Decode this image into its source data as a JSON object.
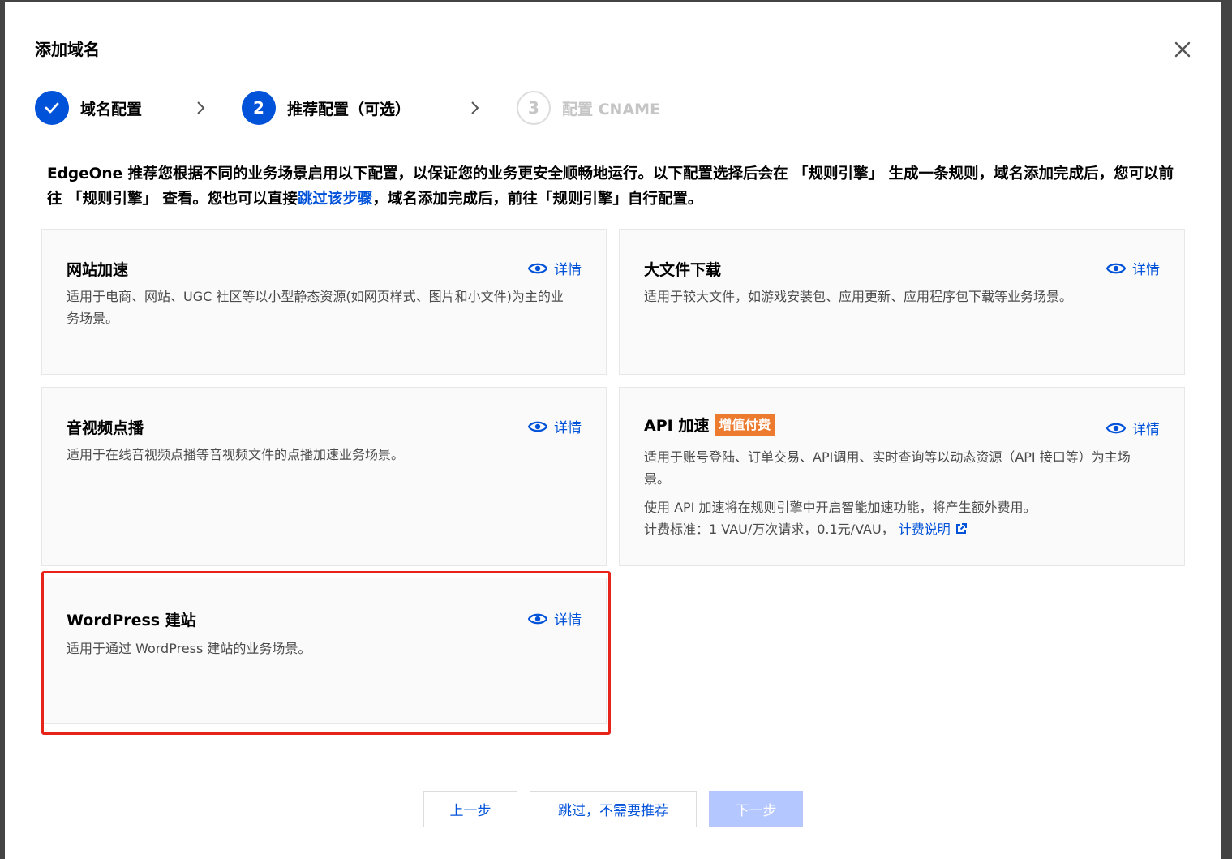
{
  "dialog": {
    "title": "添加域名"
  },
  "steps": [
    {
      "number": "1",
      "label": "域名配置",
      "state": "done"
    },
    {
      "number": "2",
      "label": "推荐配置（可选）",
      "state": "active"
    },
    {
      "number": "3",
      "label": "配置 CNAME",
      "state": "pending"
    }
  ],
  "intro": {
    "text_before": "EdgeOne 推荐您根据不同的业务场景启用以下配置，以保证您的业务更安全顺畅地运行。以下配置选择后会在 「规则引擎」 生成一条规则，域名添加完成后，您可以前往 「规则引擎」 查看。您也可以直接",
    "link": "跳过该步骤",
    "text_after": "，域名添加完成后，前往「规则引擎」自行配置。"
  },
  "cards": [
    {
      "title": "网站加速",
      "detail": "详情",
      "desc": "适用于电商、网站、UGC 社区等以小型静态资源(如网页样式、图片和小文件)为主的业务场景。"
    },
    {
      "title": "大文件下载",
      "detail": "详情",
      "desc": "适用于较大文件，如游戏安装包、应用更新、应用程序包下载等业务场景。"
    },
    {
      "title": "音视频点播",
      "detail": "详情",
      "desc": "适用于在线音视频点播等音视频文件的点播加速业务场景。"
    },
    {
      "title": "API 加速",
      "badge": "增值付费",
      "detail": "详情",
      "desc": "适用于账号登陆、订单交易、API调用、实时查询等以动态资源（API 接口等）为主场景。",
      "desc2": "使用 API 加速将在规则引擎中开启智能加速功能，将产生额外费用。",
      "pricing": "计费标准：1 VAU/万次请求，0.1元/VAU，",
      "pricing_link": "计费说明"
    },
    {
      "title": "WordPress 建站",
      "detail": "详情",
      "desc": "适用于通过 WordPress 建站的业务场景。"
    }
  ],
  "footer": {
    "prev": "上一步",
    "skip": "跳过，不需要推荐",
    "next": "下一步"
  },
  "colors": {
    "primary": "#0052d9",
    "badge": "#ed7b2f",
    "highlight": "#e8231a",
    "disabled": "#b5c7ff"
  }
}
